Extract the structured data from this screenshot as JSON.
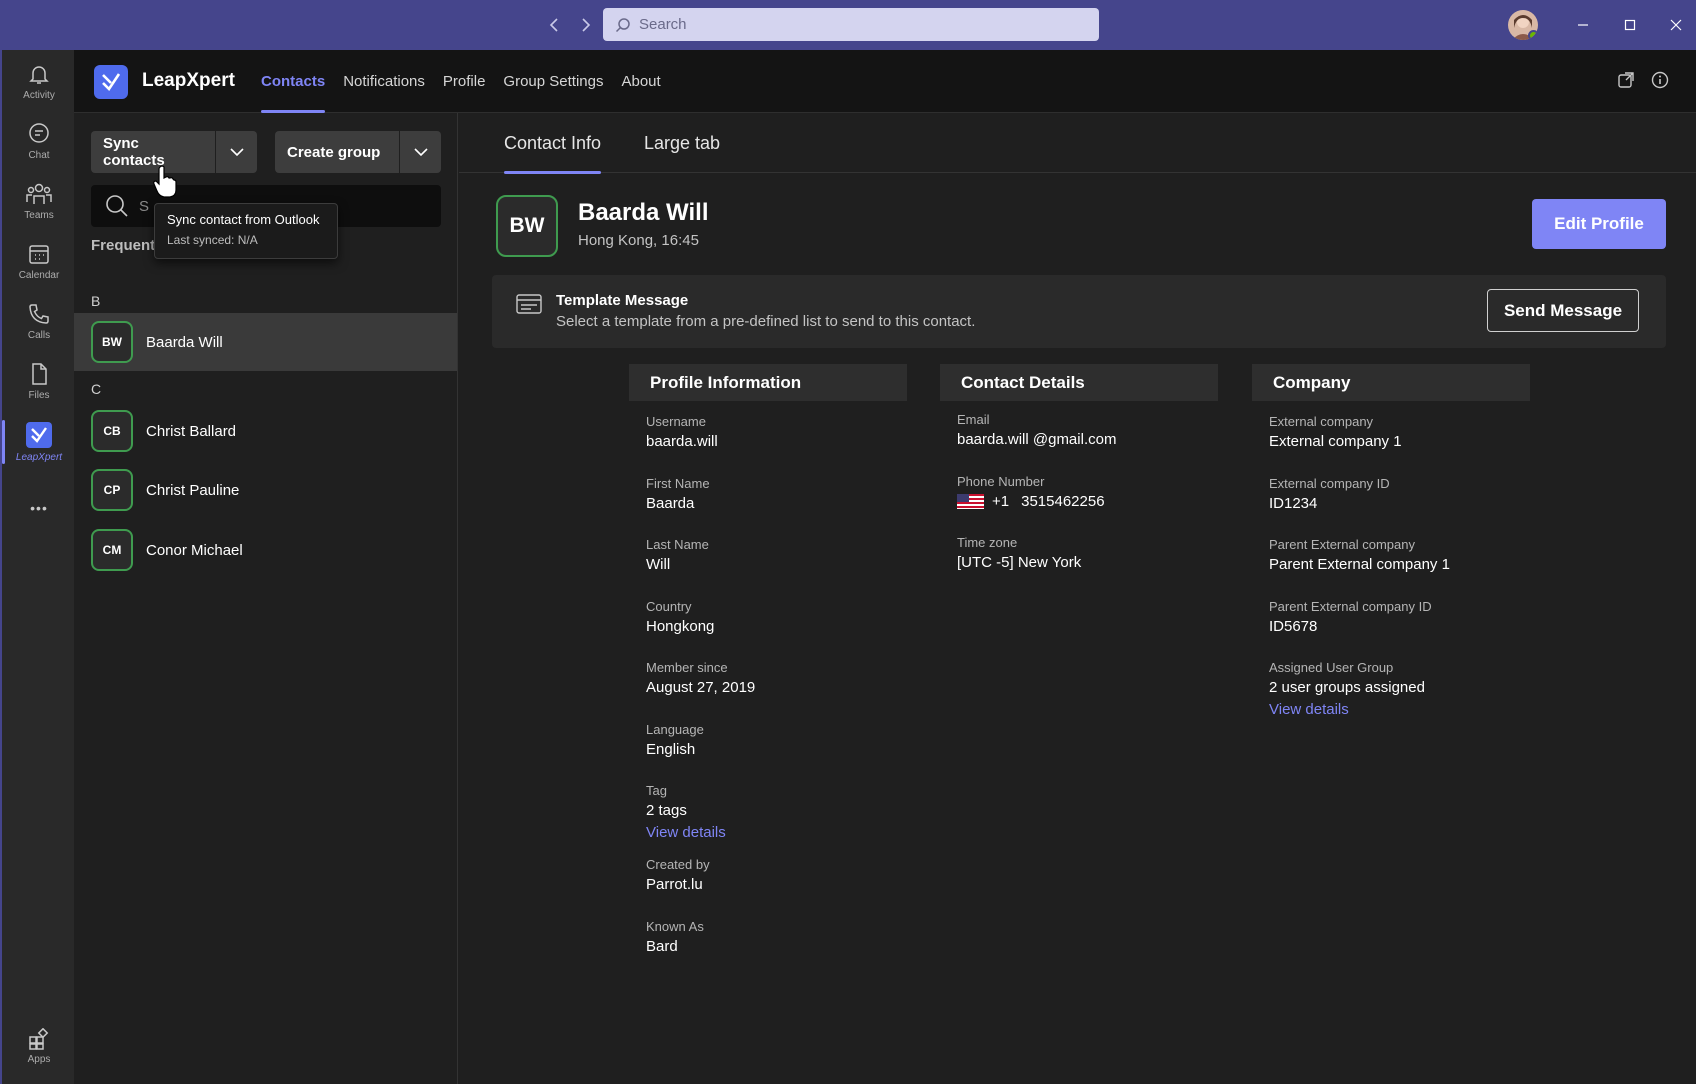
{
  "titlebar": {
    "search_placeholder": "Search",
    "accent": "#45458c"
  },
  "rail": {
    "items": [
      {
        "label": "Activity",
        "icon": "bell-icon"
      },
      {
        "label": "Chat",
        "icon": "chat-icon"
      },
      {
        "label": "Teams",
        "icon": "teams-icon"
      },
      {
        "label": "Calendar",
        "icon": "calendar-icon"
      },
      {
        "label": "Calls",
        "icon": "phone-icon"
      },
      {
        "label": "Files",
        "icon": "file-icon"
      },
      {
        "label": "LeapXpert",
        "icon": "leapxpert-icon"
      }
    ],
    "more": "•••",
    "apps_label": "Apps"
  },
  "app": {
    "brand": "LeapXpert",
    "tabs": [
      "Contacts",
      "Notifications",
      "Profile",
      "Group Settings",
      "About"
    ],
    "active_tab": "Contacts"
  },
  "contacts": {
    "sync_label": "Sync contacts",
    "create_group_label": "Create group",
    "search_placeholder": "S",
    "tooltip": {
      "line1": "Sync contact from Outlook",
      "line2": "Last synced: N/A"
    },
    "frequently_label": "Frequently contacted",
    "groups": [
      {
        "letter": "B",
        "items": [
          {
            "initials": "BW",
            "name": "Baarda Will",
            "selected": true
          }
        ]
      },
      {
        "letter": "C",
        "items": [
          {
            "initials": "CB",
            "name": "Christ Ballard"
          },
          {
            "initials": "CP",
            "name": "Christ Pauline"
          },
          {
            "initials": "CM",
            "name": "Conor Michael"
          }
        ]
      }
    ]
  },
  "detail": {
    "tabs": [
      "Contact Info",
      "Large tab"
    ],
    "initials": "BW",
    "name": "Baarda Will",
    "location": "Hong Kong, 16:45",
    "edit_label": "Edit Profile",
    "template": {
      "title": "Template Message",
      "desc": "Select a template from a pre-defined list to send to this contact.",
      "button": "Send Message"
    },
    "profile": {
      "heading": "Profile Information",
      "fields": [
        {
          "label": "Username",
          "value": "baarda.will"
        },
        {
          "label": "First Name",
          "value": "Baarda"
        },
        {
          "label": "Last Name",
          "value": "Will"
        },
        {
          "label": "Country",
          "value": "Hongkong"
        },
        {
          "label": "Member since",
          "value": "August 27, 2019"
        },
        {
          "label": "Language",
          "value": "English"
        },
        {
          "label": "Tag",
          "value": "2 tags",
          "link": "View details"
        },
        {
          "label": "Created by",
          "value": "Parrot.lu"
        },
        {
          "label": "Known As",
          "value": "Bard"
        }
      ]
    },
    "contact": {
      "heading": "Contact Details",
      "email_label": "Email",
      "email": "baarda.will @gmail.com",
      "phone_label": "Phone Number",
      "phone_code": "+1",
      "phone": "3515462256",
      "tz_label": "Time zone",
      "tz": "[UTC -5] New York"
    },
    "company": {
      "heading": "Company",
      "fields": [
        {
          "label": "External company",
          "value": "External company 1"
        },
        {
          "label": "External company ID",
          "value": "ID1234"
        },
        {
          "label": "Parent External company",
          "value": "Parent External company 1"
        },
        {
          "label": "Parent External company ID",
          "value": "ID5678"
        },
        {
          "label": "Assigned User Group",
          "value": "2 user groups assigned",
          "link": "View details"
        }
      ]
    }
  },
  "colors": {
    "accent": "#7f85f5",
    "avatar_border": "#3f9b4f"
  }
}
